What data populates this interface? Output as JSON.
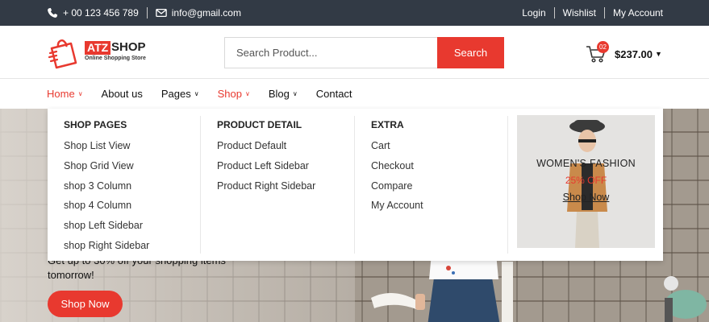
{
  "topbar": {
    "phone": "+ 00 123 456 789",
    "email": "info@gmail.com",
    "links": {
      "login": "Login",
      "wishlist": "Wishlist",
      "account": "My Account"
    }
  },
  "header": {
    "logo": {
      "brand_box": "ATZ",
      "brand_text": "SHOP",
      "tagline": "Online Shopping Store"
    },
    "search": {
      "placeholder": "Search Product...",
      "button": "Search"
    },
    "cart": {
      "count": "02",
      "total": "$237.00"
    }
  },
  "nav": {
    "items": [
      {
        "label": "Home",
        "dropdown": true,
        "active": true
      },
      {
        "label": "About us",
        "dropdown": false
      },
      {
        "label": "Pages",
        "dropdown": true
      },
      {
        "label": "Shop",
        "dropdown": true,
        "active": true
      },
      {
        "label": "Blog",
        "dropdown": true
      },
      {
        "label": "Contact",
        "dropdown": false
      }
    ]
  },
  "mega_menu": {
    "columns": [
      {
        "title": "SHOP PAGES",
        "items": [
          "Shop List View",
          "Shop Grid View",
          "shop 3 Column",
          "shop 4 Column",
          "shop Left Sidebar",
          "shop Right Sidebar"
        ]
      },
      {
        "title": "PRODUCT DETAIL",
        "items": [
          "Product Default",
          "Product Left Sidebar",
          "Product Right Sidebar"
        ]
      },
      {
        "title": "EXTRA",
        "items": [
          "Cart",
          "Checkout",
          "Compare",
          "My Account"
        ]
      }
    ],
    "promo": {
      "title": "WOMEN'S FASHION",
      "discount": "25% OFF",
      "cta": "Shop Now"
    }
  },
  "hero": {
    "text_line1": "Get up to 30% off your shopping items",
    "text_line2": "tomorrow!",
    "button": "Shop Now"
  },
  "colors": {
    "accent": "#e8392f",
    "topbar": "#323a45"
  }
}
